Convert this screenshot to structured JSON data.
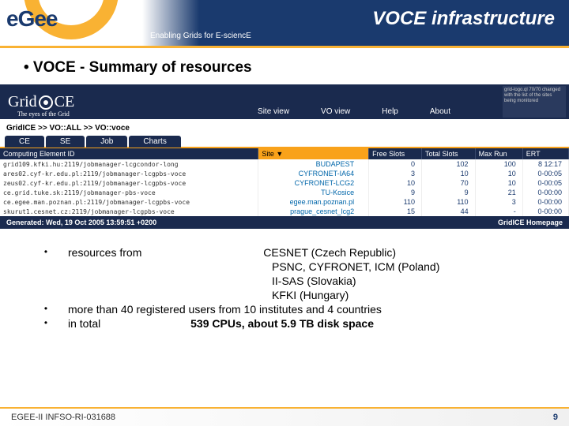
{
  "header": {
    "logo_text": "eGee",
    "title": "VOCE infrastructure",
    "tagline": "Enabling Grids for E-sciencE"
  },
  "heading": "•   VOCE - Summary of resources",
  "gridice": {
    "logo": "GridICE",
    "logo_sub": "The eyes of the Grid",
    "menu": [
      "Site view",
      "VO view",
      "Help",
      "About"
    ],
    "stats_text": "grid-logo.ql 70/70 changed with the list of the sites being monitored",
    "breadcrumb": "GridICE >> VO::ALL >> VO::voce",
    "tabs": [
      "CE",
      "SE",
      "Job",
      "Charts"
    ],
    "columns": [
      "Computing Element ID",
      "Site ▼",
      "Free Slots",
      "Total Slots",
      "Max Run",
      "ERT"
    ],
    "rows": [
      {
        "ce": "grid109.kfki.hu:2119/jobmanager-lcgcondor-long",
        "site": "BUDAPEST",
        "free": "0",
        "total": "102",
        "max": "100",
        "ert": "8 12:17"
      },
      {
        "ce": "ares02.cyf-kr.edu.pl:2119/jobmanager-lcgpbs-voce",
        "site": "CYFRONET-IA64",
        "free": "3",
        "total": "10",
        "max": "10",
        "ert": "0-00:05"
      },
      {
        "ce": "zeus02.cyf-kr.edu.pl:2119/jobmanager-lcgpbs-voce",
        "site": "CYFRONET-LCG2",
        "free": "10",
        "total": "70",
        "max": "10",
        "ert": "0-00:05"
      },
      {
        "ce": "ce.grid.tuke.sk:2119/jobmanager-pbs-voce",
        "site": "TU-Kosice",
        "free": "9",
        "total": "9",
        "max": "21",
        "ert": "0-00:00"
      },
      {
        "ce": "ce.egee.man.poznan.pl:2119/jobmanager-lcgpbs-voce",
        "site": "egee.man.poznan.pl",
        "free": "110",
        "total": "110",
        "max": "3",
        "ert": "0-00:00"
      },
      {
        "ce": "skurut1.cesnet.cz:2119/jobmanager-lcgpbs-voce",
        "site": "prague_cesnet_lcg2",
        "free": "15",
        "total": "44",
        "max": "-",
        "ert": "0-00:00"
      }
    ],
    "footer_left": "Generated: Wed, 19 Oct 2005 13:59:51 +0200",
    "footer_right": "GridICE Homepage"
  },
  "bullets": {
    "b1_label": "resources from",
    "r1": "CESNET (Czech Republic)",
    "r2": "PSNC, CYFRONET, ICM (Poland)",
    "r3": "II-SAS (Slovakia)",
    "r4": "KFKI (Hungary)",
    "b2": "more than 40 registered users from 10 institutes and 4 countries",
    "b3_pre": "in total",
    "b3_strong": "539 CPUs, about 5.9 TB disk space"
  },
  "footer": {
    "left": "EGEE-II INFSO-RI-031688",
    "right": "9"
  }
}
